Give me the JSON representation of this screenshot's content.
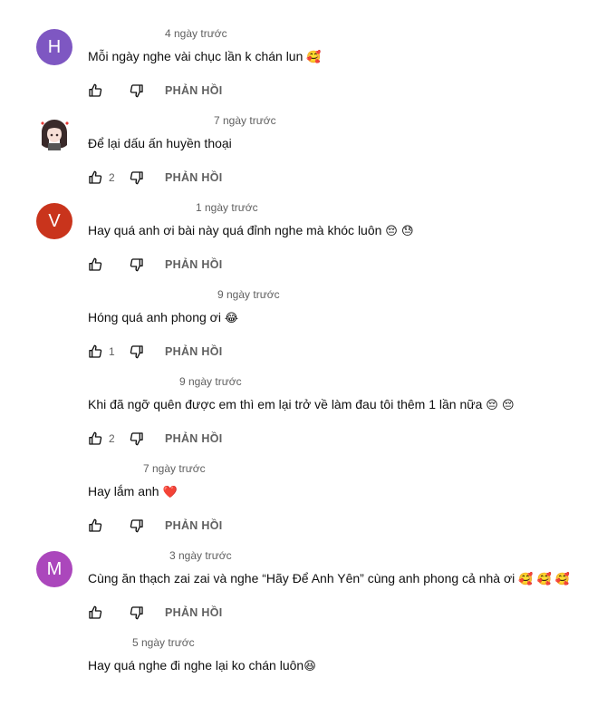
{
  "reply_label": "PHẢN HỒI",
  "comments": [
    {
      "author": "",
      "avatar_letter": "H",
      "avatar_color": "#7e57c2",
      "time": "4 ngày trước",
      "text": "Mỗi ngày nghe vài chục lần k chán lun",
      "emoji": "🥰",
      "likes": ""
    },
    {
      "author": "",
      "avatar_letter": "",
      "avatar_color": "#ffffff",
      "time": "7 ngày trước",
      "text": "Để lại dấu ấn huyền thoại",
      "emoji": "",
      "likes": "2"
    },
    {
      "author": "",
      "avatar_letter": "V",
      "avatar_color": "#c9341c",
      "time": "1 ngày trước",
      "text": "Hay quá anh ơi bài này quá đỉnh nghe mà khóc luôn",
      "emoji": "😔 😓",
      "likes": ""
    },
    {
      "author": "",
      "avatar_letter": "",
      "avatar_color": "#ffffff",
      "time": "9 ngày trước",
      "text": "Hóng quá anh phong ơi",
      "emoji": "😂",
      "likes": "1"
    },
    {
      "author": "",
      "avatar_letter": "",
      "avatar_color": "#ffffff",
      "time": "9 ngày trước",
      "text": "Khi đã ngỡ quên được em thì em lại trở về làm đau tôi thêm 1 lần nữa",
      "emoji": "😔 😔",
      "likes": "2"
    },
    {
      "author": "",
      "avatar_letter": "",
      "avatar_color": "#ffffff",
      "time": "7 ngày trước",
      "text": "Hay lắm anh",
      "emoji": "❤️",
      "likes": ""
    },
    {
      "author": "",
      "avatar_letter": "M",
      "avatar_color": "#ab47bc",
      "time": "3 ngày trước",
      "text": "Cùng ăn thạch zai zai và nghe “Hãy Để Anh Yên” cùng anh phong cả nhà ơi",
      "emoji": "🥰 🥰 🥰",
      "likes": ""
    },
    {
      "author": "",
      "avatar_letter": "",
      "avatar_color": "#ffffff",
      "time": "5 ngày trước",
      "text": "Hay quá nghe đi nghe lại ko chán luôn",
      "emoji": "😆",
      "likes": ""
    }
  ]
}
